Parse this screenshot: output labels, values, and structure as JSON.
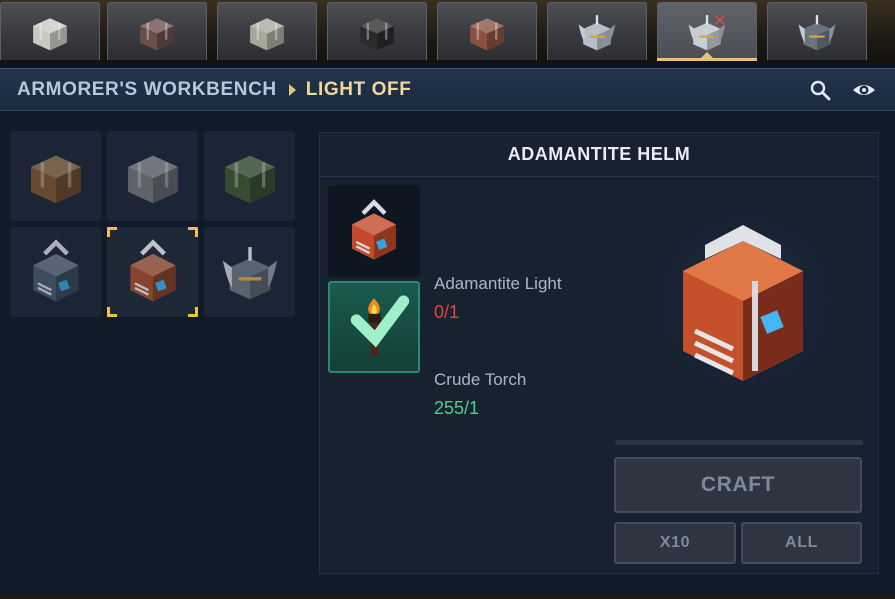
{
  "tabs": [
    {
      "icon": "light-armor-chest-icon"
    },
    {
      "icon": "red-armor-chest-icon"
    },
    {
      "icon": "stone-armor-legs-icon"
    },
    {
      "icon": "dark-armor-chest-icon"
    },
    {
      "icon": "leather-armor-legs-icon"
    },
    {
      "icon": "winged-helm-icon"
    },
    {
      "icon": "winged-helm-off-icon",
      "active": true
    },
    {
      "icon": "winged-helm-dark-icon"
    }
  ],
  "header": {
    "workbench": "ARMORER'S WORKBENCH",
    "category": "LIGHT OFF",
    "search_icon": "search-icon",
    "view_icon": "eye-icon"
  },
  "recipes": [
    {
      "icon": "copper-chest-icon"
    },
    {
      "icon": "iron-chest-icon"
    },
    {
      "icon": "thorium-chest-icon"
    },
    {
      "icon": "cobalt-helm-icon"
    },
    {
      "icon": "adamantite-helm-icon",
      "selected": true
    },
    {
      "icon": "mithril-winged-helm-icon"
    }
  ],
  "detail": {
    "title": "ADAMANTITE HELM",
    "ingredients": [
      {
        "name": "Adamantite Light",
        "count": "0/1",
        "status": "insufficient",
        "icon": "adamantite-light-icon"
      },
      {
        "name": "Crude Torch",
        "count": "255/1",
        "status": "sufficient",
        "icon": "crude-torch-icon"
      }
    ],
    "preview_icon": "adamantite-helm-icon"
  },
  "actions": {
    "craft": "CRAFT",
    "x10": "X10",
    "all": "ALL"
  },
  "colors": {
    "accent": "#e6c27a",
    "insufficient": "#e2473c",
    "sufficient": "#4fd08a",
    "selected_corner": "#f0c040"
  }
}
